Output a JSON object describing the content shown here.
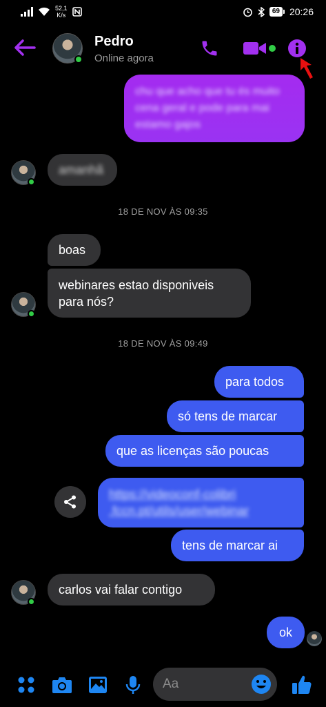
{
  "status_bar": {
    "speed_top": "52,1",
    "speed_bottom": "K/s",
    "battery": "69",
    "time": "20:26"
  },
  "header": {
    "name": "Pedro",
    "status": "Online agora"
  },
  "messages": {
    "m1": "chu que acho que tu és muito cena geral e pode para mai estamo gajos",
    "m2": "amanhã",
    "ts1": "18 DE NOV ÀS 09:35",
    "m3": "boas",
    "m4_line1": "webinares estao disponiveis",
    "m4_line2": "para nós?",
    "ts2": "18 DE NOV ÀS 09:49",
    "m5": "para todos",
    "m6": "só tens de marcar",
    "m7": "que as licenças são poucas",
    "m8_line1": "https://videoconf-colibri",
    "m8_line2": ".fccn.pt/utils/user/webinar",
    "m9": "tens de marcar ai",
    "m10": "carlos vai falar contigo",
    "m11": "ok"
  },
  "composer": {
    "placeholder": "Aa"
  },
  "colors": {
    "accent_purple": "#a230ef",
    "messenger_blue": "#3e5bf0",
    "online_green": "#31cc46",
    "composer_blue": "#1e86f2"
  }
}
